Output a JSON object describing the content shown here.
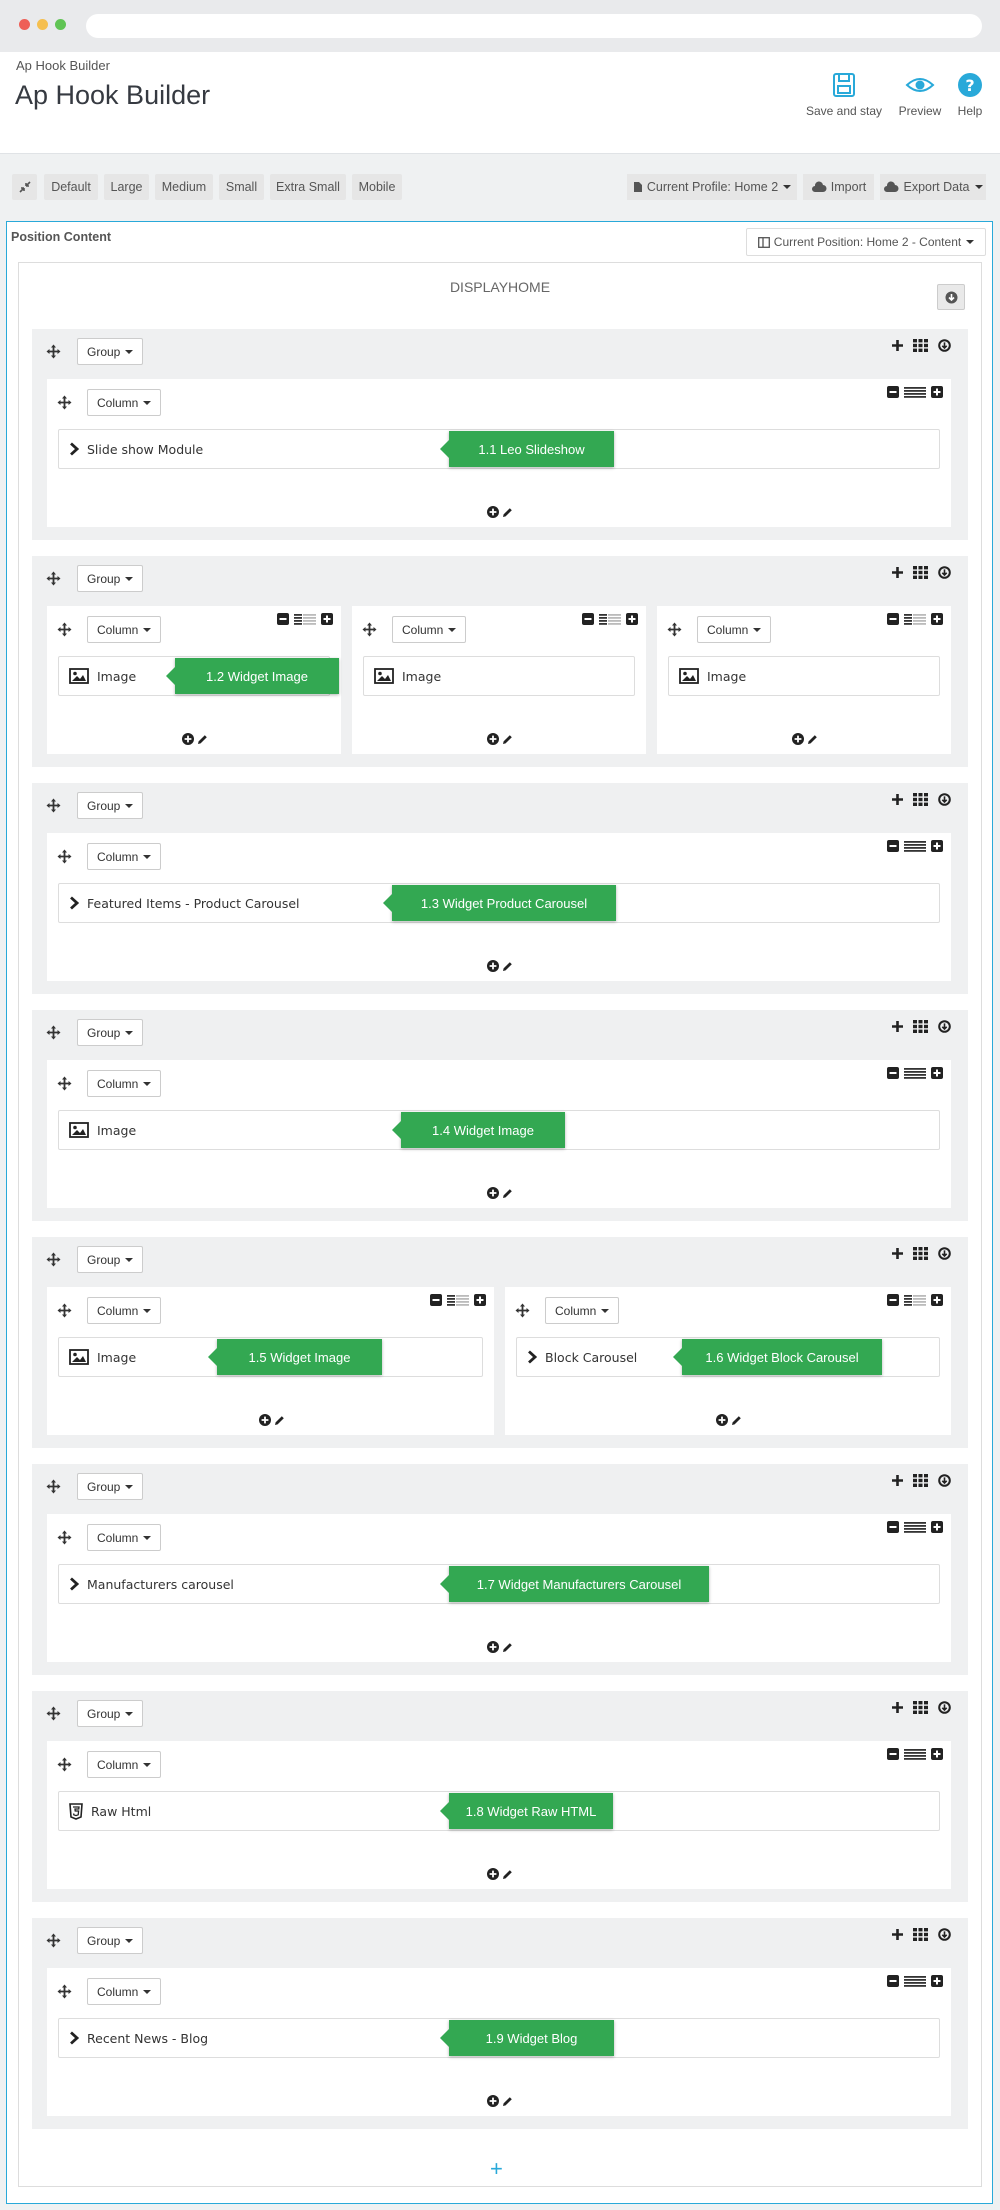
{
  "breadcrumb": "Ap Hook Builder",
  "page_title": "Ap Hook Builder",
  "toolbar": {
    "save_stay": "Save and stay",
    "preview": "Preview",
    "help": "Help"
  },
  "breakpoints": [
    "Default",
    "Large",
    "Medium",
    "Small",
    "Extra Small",
    "Mobile"
  ],
  "profile_label": "Current Profile: Home 2",
  "import_label": "Import",
  "export_label": "Export Data",
  "position_content_label": "Position Content",
  "current_position_label": "Current Position: Home 2 - Content",
  "hook_name": "DISPLAYHOME",
  "group_label": "Group",
  "column_label": "Column",
  "colors": {
    "accent": "#29a9d9",
    "tag": "#33a852"
  },
  "groups": [
    {
      "columns": [
        {
          "widgets": [
            {
              "icon": "chevron-right-icon",
              "label": "Slide show Module",
              "tag": "1.1 Leo Slideshow"
            }
          ]
        }
      ]
    },
    {
      "columns": [
        {
          "widgets": [
            {
              "icon": "image-icon",
              "label": "Image",
              "tag": "1.2 Widget Image"
            }
          ]
        },
        {
          "widgets": [
            {
              "icon": "image-icon",
              "label": "Image"
            }
          ]
        },
        {
          "widgets": [
            {
              "icon": "image-icon",
              "label": "Image"
            }
          ]
        }
      ]
    },
    {
      "columns": [
        {
          "widgets": [
            {
              "icon": "chevron-right-icon",
              "label": "Featured Items - Product Carousel",
              "tag": "1.3 Widget Product Carousel"
            }
          ]
        }
      ]
    },
    {
      "columns": [
        {
          "widgets": [
            {
              "icon": "image-icon",
              "label": "Image",
              "tag": "1.4 Widget Image"
            }
          ]
        }
      ]
    },
    {
      "columns": [
        {
          "widgets": [
            {
              "icon": "image-icon",
              "label": "Image",
              "tag": "1.5 Widget Image"
            }
          ]
        },
        {
          "widgets": [
            {
              "icon": "chevron-right-icon",
              "label": "Block Carousel",
              "tag": "1.6 Widget Block Carousel"
            }
          ]
        }
      ]
    },
    {
      "columns": [
        {
          "widgets": [
            {
              "icon": "chevron-right-icon",
              "label": "Manufacturers carousel",
              "tag": "1.7 Widget Manufacturers Carousel"
            }
          ]
        }
      ]
    },
    {
      "columns": [
        {
          "widgets": [
            {
              "icon": "html5-icon",
              "label": "Raw Html",
              "tag": "1.8 Widget Raw HTML"
            }
          ]
        }
      ]
    },
    {
      "columns": [
        {
          "widgets": [
            {
              "icon": "chevron-right-icon",
              "label": "Recent News - Blog",
              "tag": "1.9 Widget Blog"
            }
          ]
        }
      ]
    }
  ]
}
